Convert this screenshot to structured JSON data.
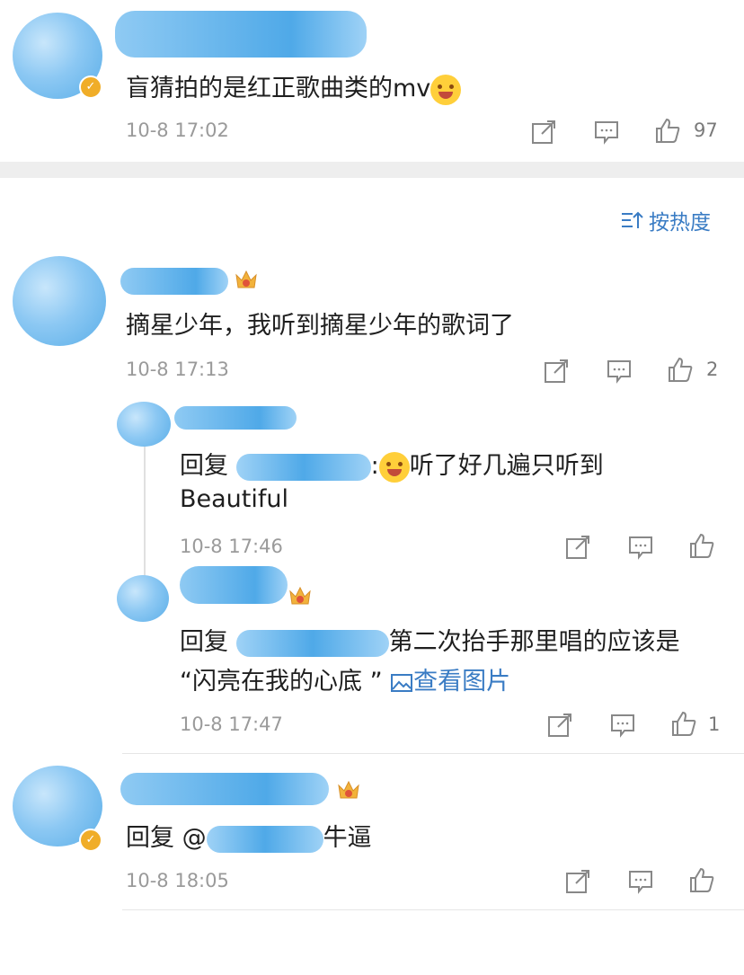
{
  "comments": [
    {
      "text": "盲猜拍的是红正歌曲类的mv",
      "time": "10-8 17:02",
      "likes": "97"
    },
    {
      "text": "摘星少年，我听到摘星少年的歌词了",
      "time": "10-8 17:13",
      "likes": "2"
    }
  ],
  "sort_label": "按热度",
  "replies": [
    {
      "prefix": "回复",
      "suffix_line1": "听了好几遍只听到",
      "line2": "Beautiful",
      "time": "10-8 17:46"
    },
    {
      "prefix": "回复",
      "suffix_line1": "第二次抬手那里唱的应该是",
      "line2": "“闪亮在我的心底 ”",
      "image_link": "查看图片",
      "time": "10-8 17:47",
      "likes": "1"
    }
  ],
  "last_comment": {
    "prefix": "回复 @",
    "suffix": "牛逼",
    "time": "10-8 18:05"
  },
  "colors": {
    "link": "#3a7cc4",
    "mask": "#5fb0ea",
    "verified": "#f0ad28"
  }
}
